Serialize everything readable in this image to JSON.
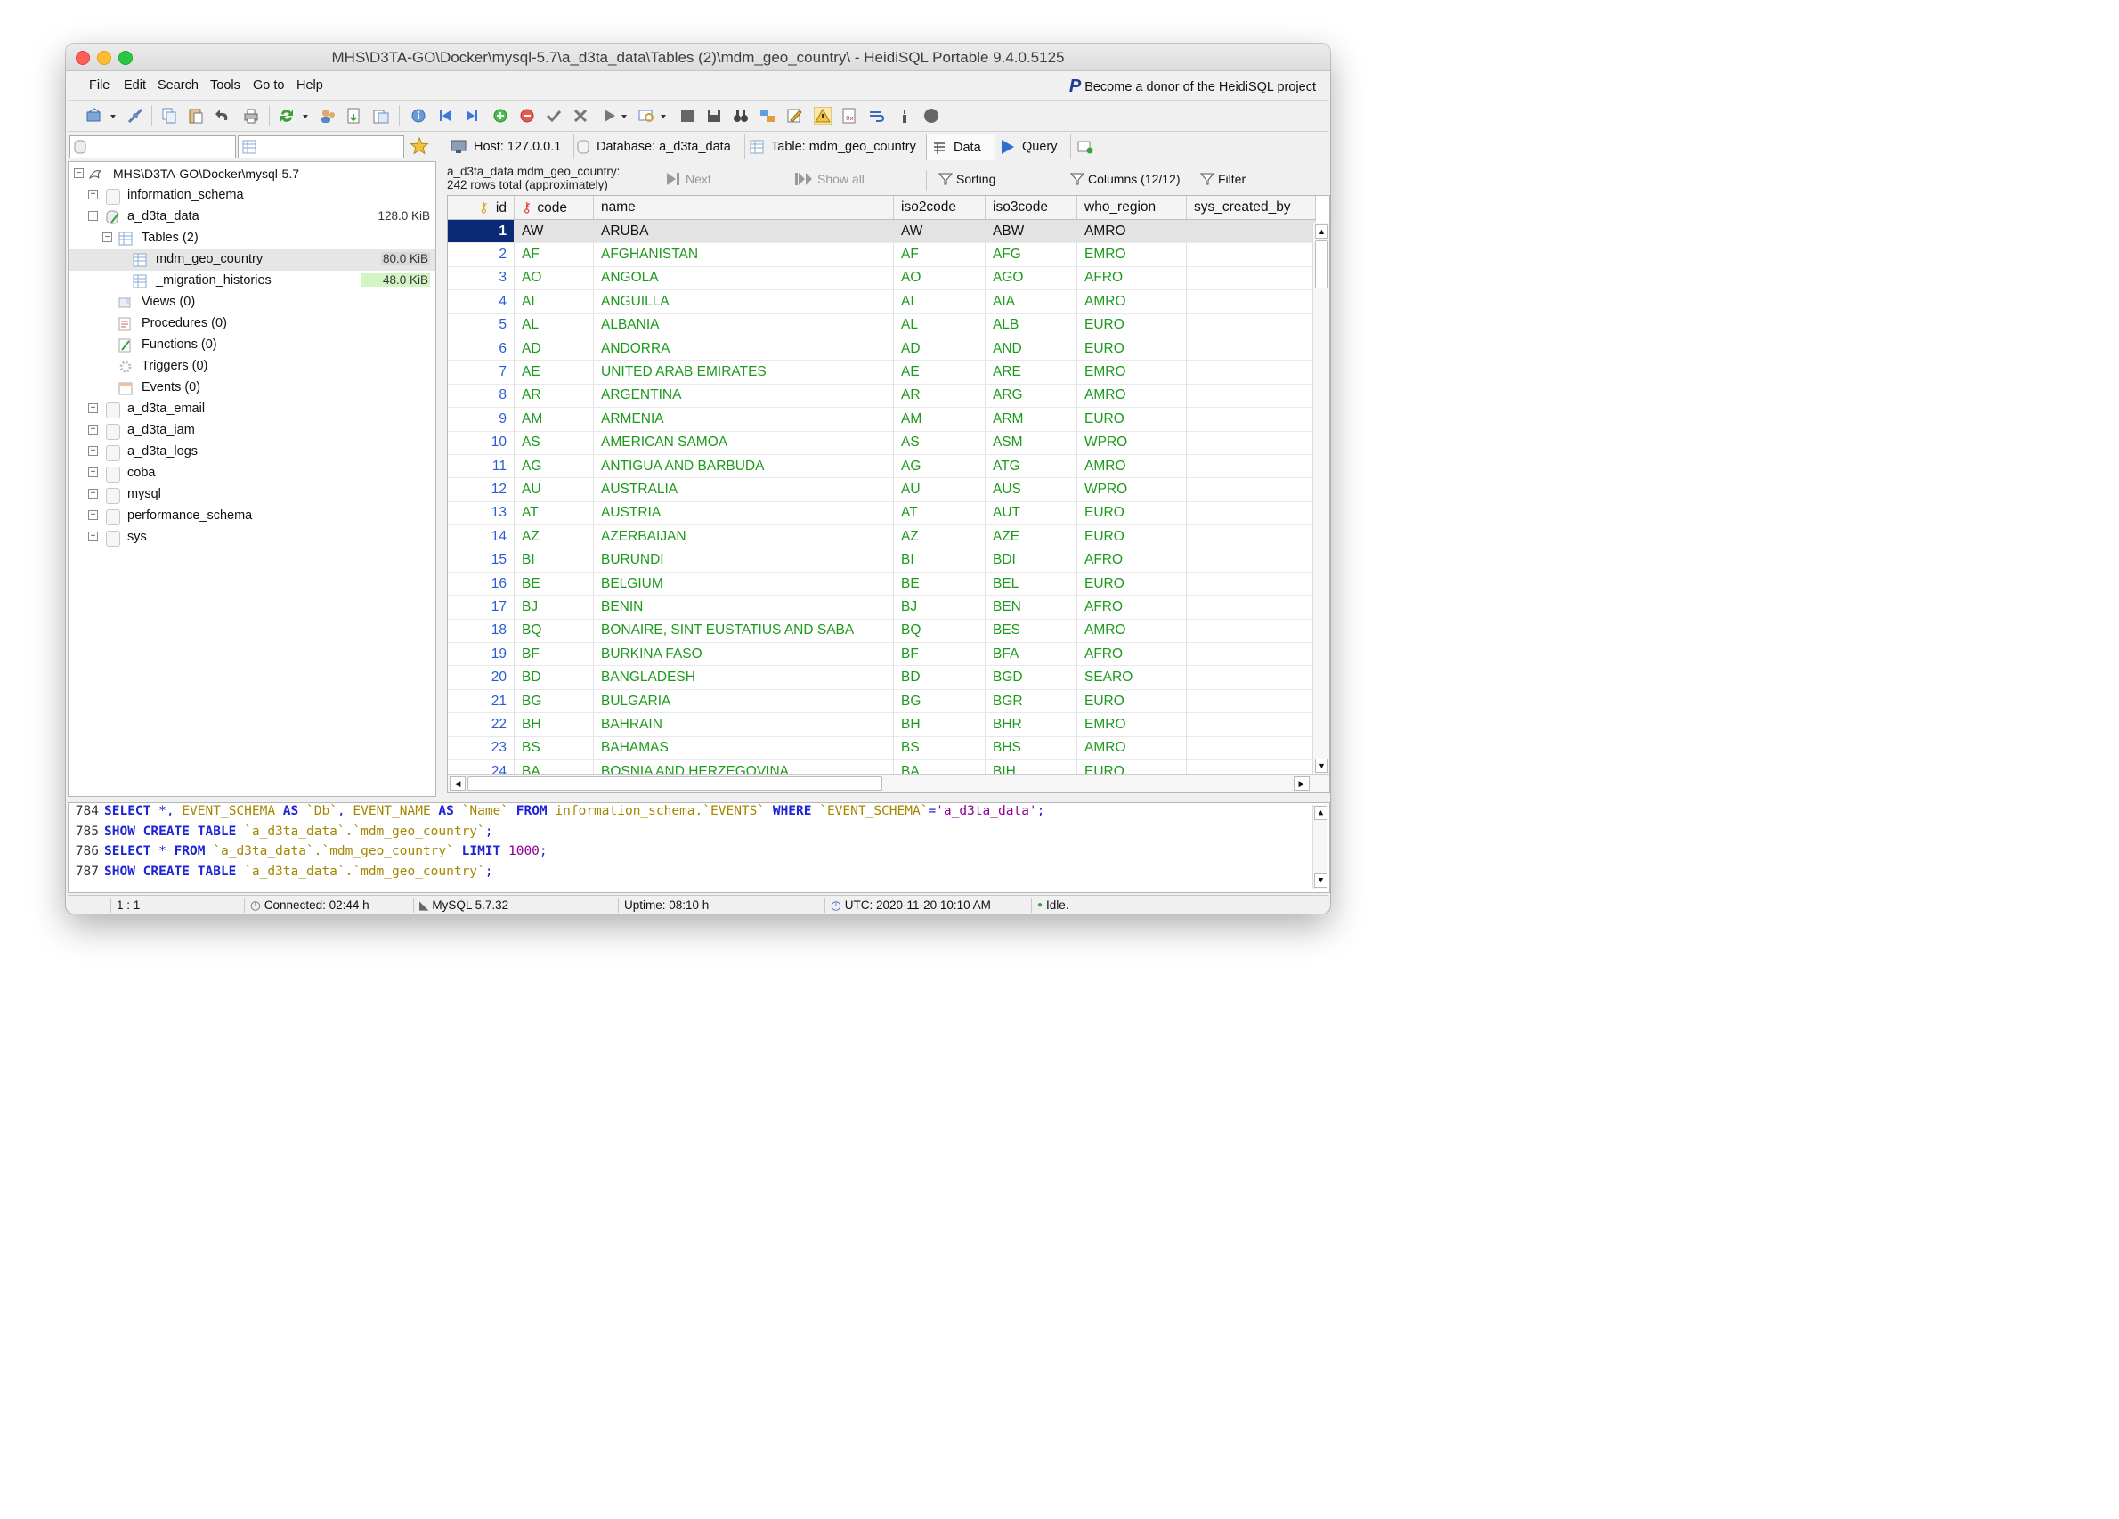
{
  "window": {
    "title": "MHS\\D3TA-GO\\Docker\\mysql-5.7\\a_d3ta_data\\Tables (2)\\mdm_geo_country\\ - HeidiSQL Portable 9.4.0.5125"
  },
  "menu": [
    "File",
    "Edit",
    "Search",
    "Tools",
    "Go to",
    "Help"
  ],
  "donor": "Become a donor of the HeidiSQL project",
  "tabs": {
    "host": "Host: 127.0.0.1",
    "database": "Database: a_d3ta_data",
    "table": "Table: mdm_geo_country",
    "data": "Data",
    "query": "Query"
  },
  "tree": {
    "root": "MHS\\D3TA-GO\\Docker\\mysql-5.7",
    "information_schema": "information_schema",
    "a_d3ta_data": {
      "name": "a_d3ta_data",
      "size": "128.0 KiB"
    },
    "tables_group": "Tables (2)",
    "table1": {
      "name": "mdm_geo_country",
      "size": "80.0 KiB"
    },
    "table2": {
      "name": "_migration_histories",
      "size": "48.0 KiB"
    },
    "views": "Views (0)",
    "procedures": "Procedures (0)",
    "functions": "Functions (0)",
    "triggers": "Triggers (0)",
    "events": "Events (0)",
    "a_d3ta_email": "a_d3ta_email",
    "a_d3ta_iam": "a_d3ta_iam",
    "a_d3ta_logs": "a_d3ta_logs",
    "coba": "coba",
    "mysql": "mysql",
    "performance_schema": "performance_schema",
    "sys": "sys"
  },
  "grid": {
    "info_line1": "a_d3ta_data.mdm_geo_country:",
    "info_line2": "242 rows total (approximately)",
    "next": "Next",
    "show_all": "Show all",
    "sorting": "Sorting",
    "columns_btn": "Columns (12/12)",
    "filter": "Filter",
    "columns": [
      "id",
      "code",
      "name",
      "iso2code",
      "iso3code",
      "who_region",
      "sys_created_by"
    ],
    "rows": [
      {
        "id": "1",
        "code": "AW",
        "name": "ARUBA",
        "iso2": "AW",
        "iso3": "ABW",
        "who": "AMRO"
      },
      {
        "id": "2",
        "code": "AF",
        "name": "AFGHANISTAN",
        "iso2": "AF",
        "iso3": "AFG",
        "who": "EMRO"
      },
      {
        "id": "3",
        "code": "AO",
        "name": "ANGOLA",
        "iso2": "AO",
        "iso3": "AGO",
        "who": "AFRO"
      },
      {
        "id": "4",
        "code": "AI",
        "name": "ANGUILLA",
        "iso2": "AI",
        "iso3": "AIA",
        "who": "AMRO"
      },
      {
        "id": "5",
        "code": "AL",
        "name": "ALBANIA",
        "iso2": "AL",
        "iso3": "ALB",
        "who": "EURO"
      },
      {
        "id": "6",
        "code": "AD",
        "name": "ANDORRA",
        "iso2": "AD",
        "iso3": "AND",
        "who": "EURO"
      },
      {
        "id": "7",
        "code": "AE",
        "name": "UNITED ARAB EMIRATES",
        "iso2": "AE",
        "iso3": "ARE",
        "who": "EMRO"
      },
      {
        "id": "8",
        "code": "AR",
        "name": "ARGENTINA",
        "iso2": "AR",
        "iso3": "ARG",
        "who": "AMRO"
      },
      {
        "id": "9",
        "code": "AM",
        "name": "ARMENIA",
        "iso2": "AM",
        "iso3": "ARM",
        "who": "EURO"
      },
      {
        "id": "10",
        "code": "AS",
        "name": "AMERICAN SAMOA",
        "iso2": "AS",
        "iso3": "ASM",
        "who": "WPRO"
      },
      {
        "id": "11",
        "code": "AG",
        "name": "ANTIGUA AND BARBUDA",
        "iso2": "AG",
        "iso3": "ATG",
        "who": "AMRO"
      },
      {
        "id": "12",
        "code": "AU",
        "name": "AUSTRALIA",
        "iso2": "AU",
        "iso3": "AUS",
        "who": "WPRO"
      },
      {
        "id": "13",
        "code": "AT",
        "name": "AUSTRIA",
        "iso2": "AT",
        "iso3": "AUT",
        "who": "EURO"
      },
      {
        "id": "14",
        "code": "AZ",
        "name": "AZERBAIJAN",
        "iso2": "AZ",
        "iso3": "AZE",
        "who": "EURO"
      },
      {
        "id": "15",
        "code": "BI",
        "name": "BURUNDI",
        "iso2": "BI",
        "iso3": "BDI",
        "who": "AFRO"
      },
      {
        "id": "16",
        "code": "BE",
        "name": "BELGIUM",
        "iso2": "BE",
        "iso3": "BEL",
        "who": "EURO"
      },
      {
        "id": "17",
        "code": "BJ",
        "name": "BENIN",
        "iso2": "BJ",
        "iso3": "BEN",
        "who": "AFRO"
      },
      {
        "id": "18",
        "code": "BQ",
        "name": "BONAIRE, SINT EUSTATIUS AND SABA",
        "iso2": "BQ",
        "iso3": "BES",
        "who": "AMRO"
      },
      {
        "id": "19",
        "code": "BF",
        "name": "BURKINA FASO",
        "iso2": "BF",
        "iso3": "BFA",
        "who": "AFRO"
      },
      {
        "id": "20",
        "code": "BD",
        "name": "BANGLADESH",
        "iso2": "BD",
        "iso3": "BGD",
        "who": "SEARO"
      },
      {
        "id": "21",
        "code": "BG",
        "name": "BULGARIA",
        "iso2": "BG",
        "iso3": "BGR",
        "who": "EURO"
      },
      {
        "id": "22",
        "code": "BH",
        "name": "BAHRAIN",
        "iso2": "BH",
        "iso3": "BHR",
        "who": "EMRO"
      },
      {
        "id": "23",
        "code": "BS",
        "name": "BAHAMAS",
        "iso2": "BS",
        "iso3": "BHS",
        "who": "AMRO"
      },
      {
        "id": "24",
        "code": "BA",
        "name": "BOSNIA AND HERZEGOVINA",
        "iso2": "BA",
        "iso3": "BIH",
        "who": "EURO"
      }
    ]
  },
  "sql_log": [
    {
      "n": "784",
      "parts": [
        [
          "kw",
          "SELECT"
        ],
        [
          "sym",
          " *, "
        ],
        [
          "id2",
          "EVENT_SCHEMA"
        ],
        [
          "kw",
          " AS "
        ],
        [
          "id2",
          "`Db`"
        ],
        [
          "sym",
          ", "
        ],
        [
          "id2",
          "EVENT_NAME"
        ],
        [
          "kw",
          " AS "
        ],
        [
          "id2",
          "`Name`"
        ],
        [
          "kw",
          " FROM "
        ],
        [
          "id2",
          "information_schema.`EVENTS`"
        ],
        [
          "kw",
          " WHERE "
        ],
        [
          "id2",
          "`EVENT_SCHEMA`"
        ],
        [
          "sym",
          "="
        ],
        [
          "str",
          "'a_d3ta_data'"
        ],
        [
          "sym",
          ";"
        ]
      ]
    },
    {
      "n": "785",
      "parts": [
        [
          "kw",
          "SHOW CREATE TABLE "
        ],
        [
          "id2",
          "`a_d3ta_data`.`mdm_geo_country`"
        ],
        [
          "sym",
          ";"
        ]
      ]
    },
    {
      "n": "786",
      "parts": [
        [
          "kw",
          "SELECT"
        ],
        [
          "sym",
          " * "
        ],
        [
          "kw",
          "FROM "
        ],
        [
          "id2",
          "`a_d3ta_data`.`mdm_geo_country`"
        ],
        [
          "kw",
          " LIMIT "
        ],
        [
          "num",
          "1000"
        ],
        [
          "sym",
          ";"
        ]
      ]
    },
    {
      "n": "787",
      "parts": [
        [
          "kw",
          "SHOW CREATE TABLE "
        ],
        [
          "id2",
          "`a_d3ta_data`.`mdm_geo_country`"
        ],
        [
          "sym",
          ";"
        ]
      ]
    }
  ],
  "status": {
    "position": "1 : 1",
    "connected": "Connected: 02:44 h",
    "server": "MySQL 5.7.32",
    "uptime": "Uptime: 08:10 h",
    "utc": "UTC: 2020-11-20 10:10 AM",
    "state": "Idle."
  },
  "colors": {
    "value_green": "#1c9a1c",
    "id_blue": "#2b5bd4",
    "keyword_blue": "#1d23d6",
    "identifier_olive": "#a48700",
    "string_purple": "#8d0092"
  }
}
